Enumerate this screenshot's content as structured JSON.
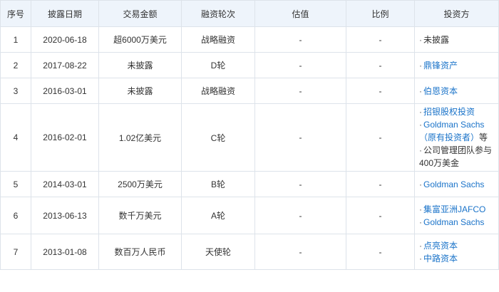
{
  "table": {
    "headers": [
      "序号",
      "披露日期",
      "交易金额",
      "融资轮次",
      "估值",
      "比例",
      "投资方"
    ],
    "rows": [
      {
        "no": "1",
        "date": "2020-06-18",
        "amount": "超6000万美元",
        "round": "战略融资",
        "valuation": "-",
        "ratio": "-",
        "investors": [
          {
            "name": "未披露",
            "link": false
          }
        ]
      },
      {
        "no": "2",
        "date": "2017-08-22",
        "amount": "未披露",
        "round": "D轮",
        "valuation": "-",
        "ratio": "-",
        "investors": [
          {
            "name": "鼎锋资产",
            "link": true
          }
        ]
      },
      {
        "no": "3",
        "date": "2016-03-01",
        "amount": "未披露",
        "round": "战略融资",
        "valuation": "-",
        "ratio": "-",
        "investors": [
          {
            "name": "伯恩资本",
            "link": true
          }
        ]
      },
      {
        "no": "4",
        "date": "2016-02-01",
        "amount": "1.02亿美元",
        "round": "C轮",
        "valuation": "-",
        "ratio": "-",
        "investors": [
          {
            "name": "招银股权投资",
            "link": true
          },
          {
            "name": "Goldman Sachs（原有投资者）",
            "link": true,
            "suffix": "等"
          },
          {
            "name": "公司管理团队参与400万美金",
            "link": false
          }
        ]
      },
      {
        "no": "5",
        "date": "2014-03-01",
        "amount": "2500万美元",
        "round": "B轮",
        "valuation": "-",
        "ratio": "-",
        "investors": [
          {
            "name": "Goldman Sachs",
            "link": true
          }
        ]
      },
      {
        "no": "6",
        "date": "2013-06-13",
        "amount": "数千万美元",
        "round": "A轮",
        "valuation": "-",
        "ratio": "-",
        "investors": [
          {
            "name": "集富亚洲JAFCO",
            "link": true
          },
          {
            "name": "Goldman Sachs",
            "link": true
          }
        ]
      },
      {
        "no": "7",
        "date": "2013-01-08",
        "amount": "数百万人民币",
        "round": "天使轮",
        "valuation": "-",
        "ratio": "-",
        "investors": [
          {
            "name": "点亮资本",
            "link": true
          },
          {
            "name": "中路资本",
            "link": true
          }
        ]
      }
    ]
  },
  "bullet_char": "·",
  "colors": {
    "header_bg": "#eef4fb",
    "border": "#dde3ea",
    "link": "#1a73c9",
    "text": "#333333"
  }
}
